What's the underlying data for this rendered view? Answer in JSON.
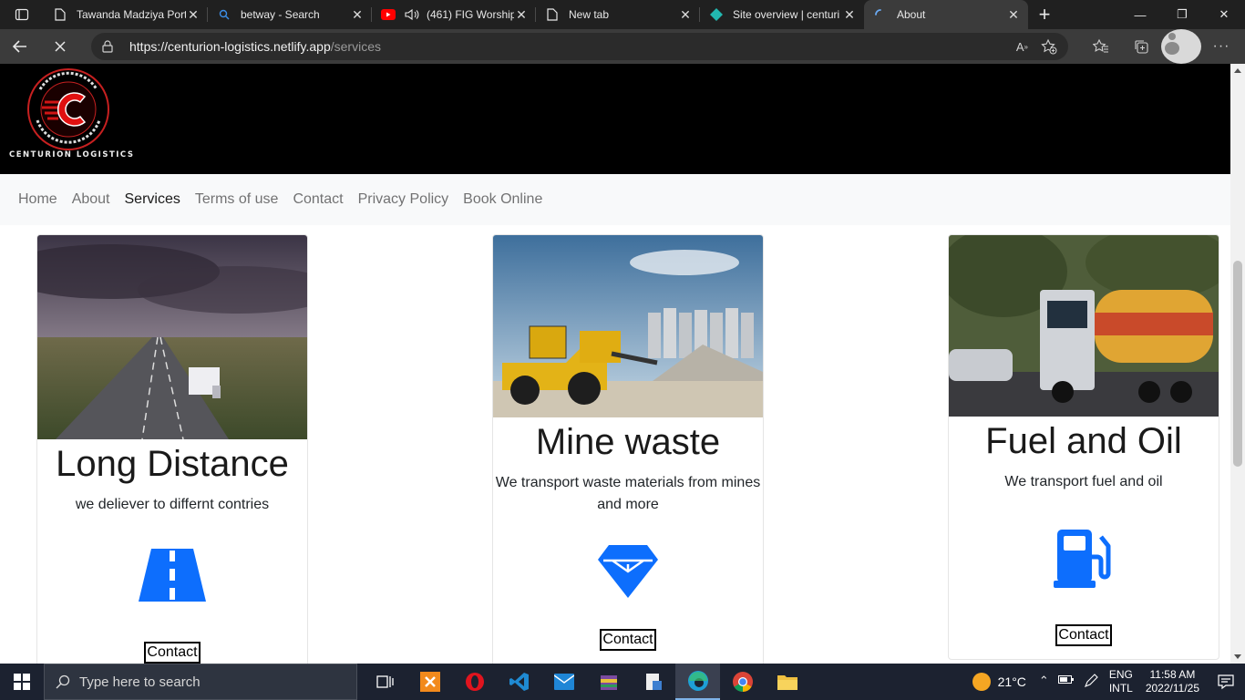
{
  "browser": {
    "tabs": [
      {
        "title": "Tawanda Madziya Port",
        "icon": "page-icon"
      },
      {
        "title": "betway - Search",
        "icon": "search-icon"
      },
      {
        "title": "(461) FIG Worship",
        "icon": "youtube-icon"
      },
      {
        "title": "New tab",
        "icon": "page-icon"
      },
      {
        "title": "Site overview | centuri",
        "icon": "netlify-icon"
      },
      {
        "title": "About",
        "icon": "loading-icon"
      }
    ],
    "url_host": "https://centurion-logistics.netlify.app",
    "url_path": "/services"
  },
  "site": {
    "brand_text": "CENTURION LOGISTICS",
    "logo_ring_text": "PROGRESS TO YOUR BUSINESS",
    "logo_letter": "C",
    "nav": [
      {
        "label": "Home"
      },
      {
        "label": "About"
      },
      {
        "label": "Services",
        "active": true
      },
      {
        "label": "Terms of use"
      },
      {
        "label": "Contact"
      },
      {
        "label": "Privacy Policy"
      },
      {
        "label": "Book Online"
      }
    ],
    "cards": [
      {
        "title": "Long Distance",
        "text": "we deliever to differnt contries",
        "icon": "road-icon",
        "button": "Contact"
      },
      {
        "title": "Mine waste",
        "text": "We transport waste materials from mines and more",
        "icon": "gem-icon",
        "button": "Contact"
      },
      {
        "title": "Fuel and Oil",
        "text": "We transport fuel and oil",
        "icon": "fuel-pump-icon",
        "button": "Contact"
      }
    ],
    "accent_color": "#0d6efd"
  },
  "taskbar": {
    "search_placeholder": "Type here to search",
    "weather": "21°C",
    "lang_line1": "ENG",
    "lang_line2": "INTL",
    "time": "11:58 AM",
    "date": "2022/11/25"
  }
}
